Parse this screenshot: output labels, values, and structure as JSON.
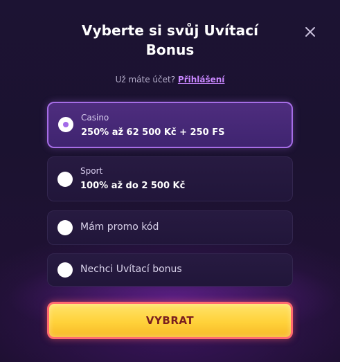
{
  "modal": {
    "title": "Vyberte si svůj Uvítací Bonus",
    "close_icon": "close-icon",
    "login_prompt": "Už máte účet?",
    "login_link": "Přihlášení"
  },
  "options": [
    {
      "id": "casino",
      "category": "Casino",
      "label": "250% až 62 500 Kč + 250 FS",
      "selected": true
    },
    {
      "id": "sport",
      "category": "Sport",
      "label": "100% až do 2 500 Kč",
      "selected": false
    },
    {
      "id": "promo",
      "label": "Mám promo kód",
      "selected": false
    },
    {
      "id": "none",
      "label": "Nechci Uvítací bonus",
      "selected": false
    }
  ],
  "cta": {
    "label": "VYBRAT"
  },
  "colors": {
    "accent": "#a66de6",
    "background": "#1c1333",
    "cta_yellow": "#ffd23a",
    "cta_border": "#ff6a6f",
    "cta_text": "#7a1f1f",
    "link": "#c987ff"
  }
}
